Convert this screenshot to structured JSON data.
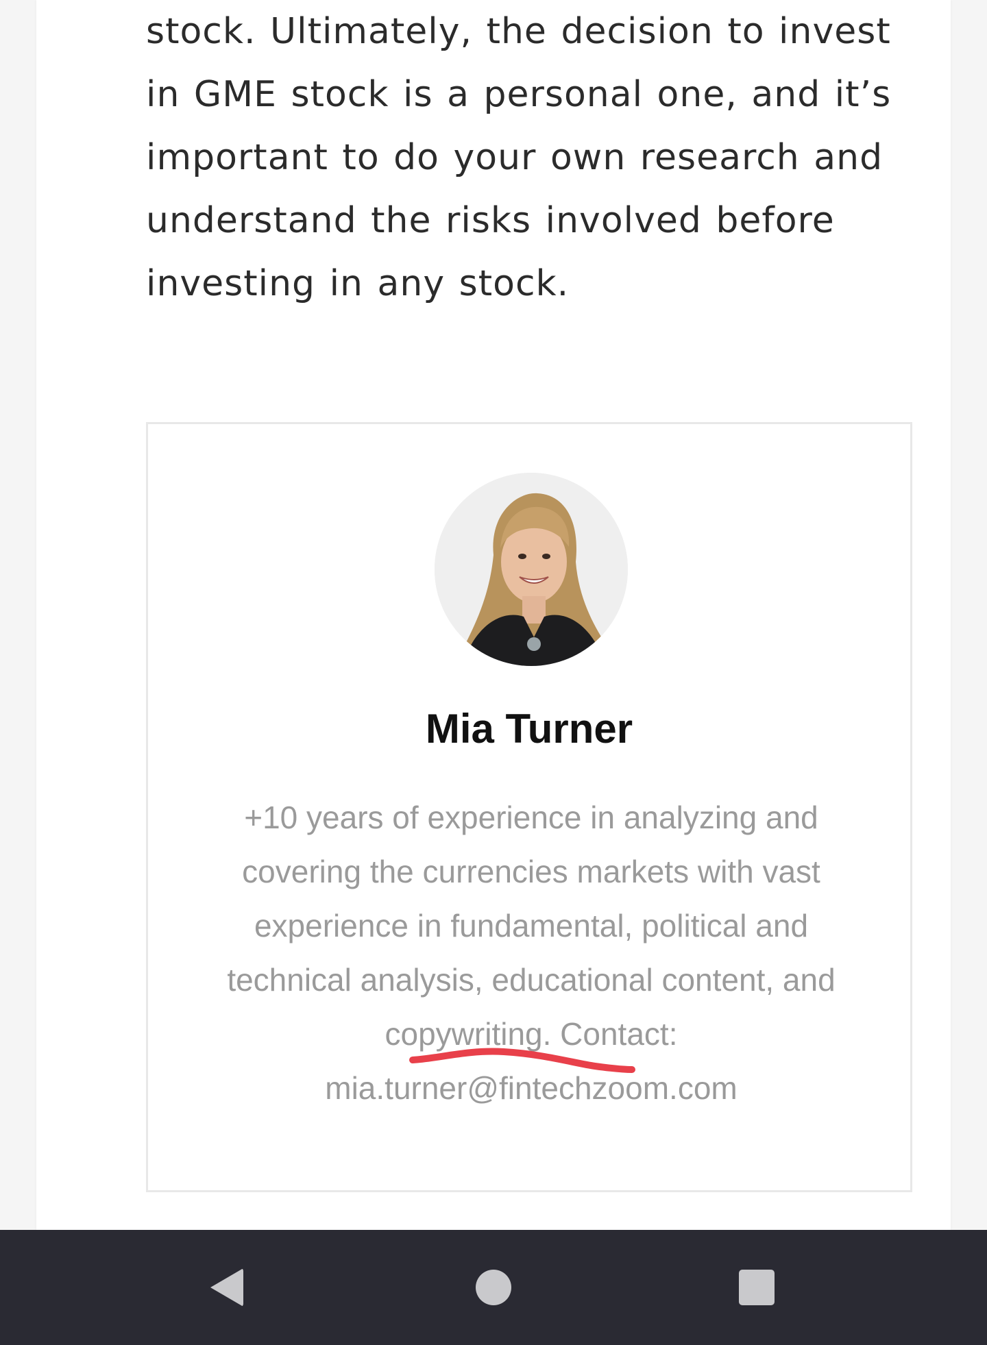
{
  "article": {
    "paragraph": "stock. Ultimately, the decision to invest in GME stock is a personal one, and it’s important to do your own research and understand the risks involved before investing in any stock."
  },
  "author": {
    "name": "Mia Turner",
    "bio": "+10 years of experience in analyzing and covering the currencies markets with vast experience in fundamental, political and technical analysis, educational content, and copywriting. Contact: mia.turner@fintechzoom.com",
    "avatar_icon": "author-photo-portrait"
  },
  "annotation": {
    "color": "#e8404a"
  },
  "nav_bar": {
    "back_icon": "back-triangle-icon",
    "home_icon": "home-circle-icon",
    "recents_icon": "recents-square-icon"
  }
}
